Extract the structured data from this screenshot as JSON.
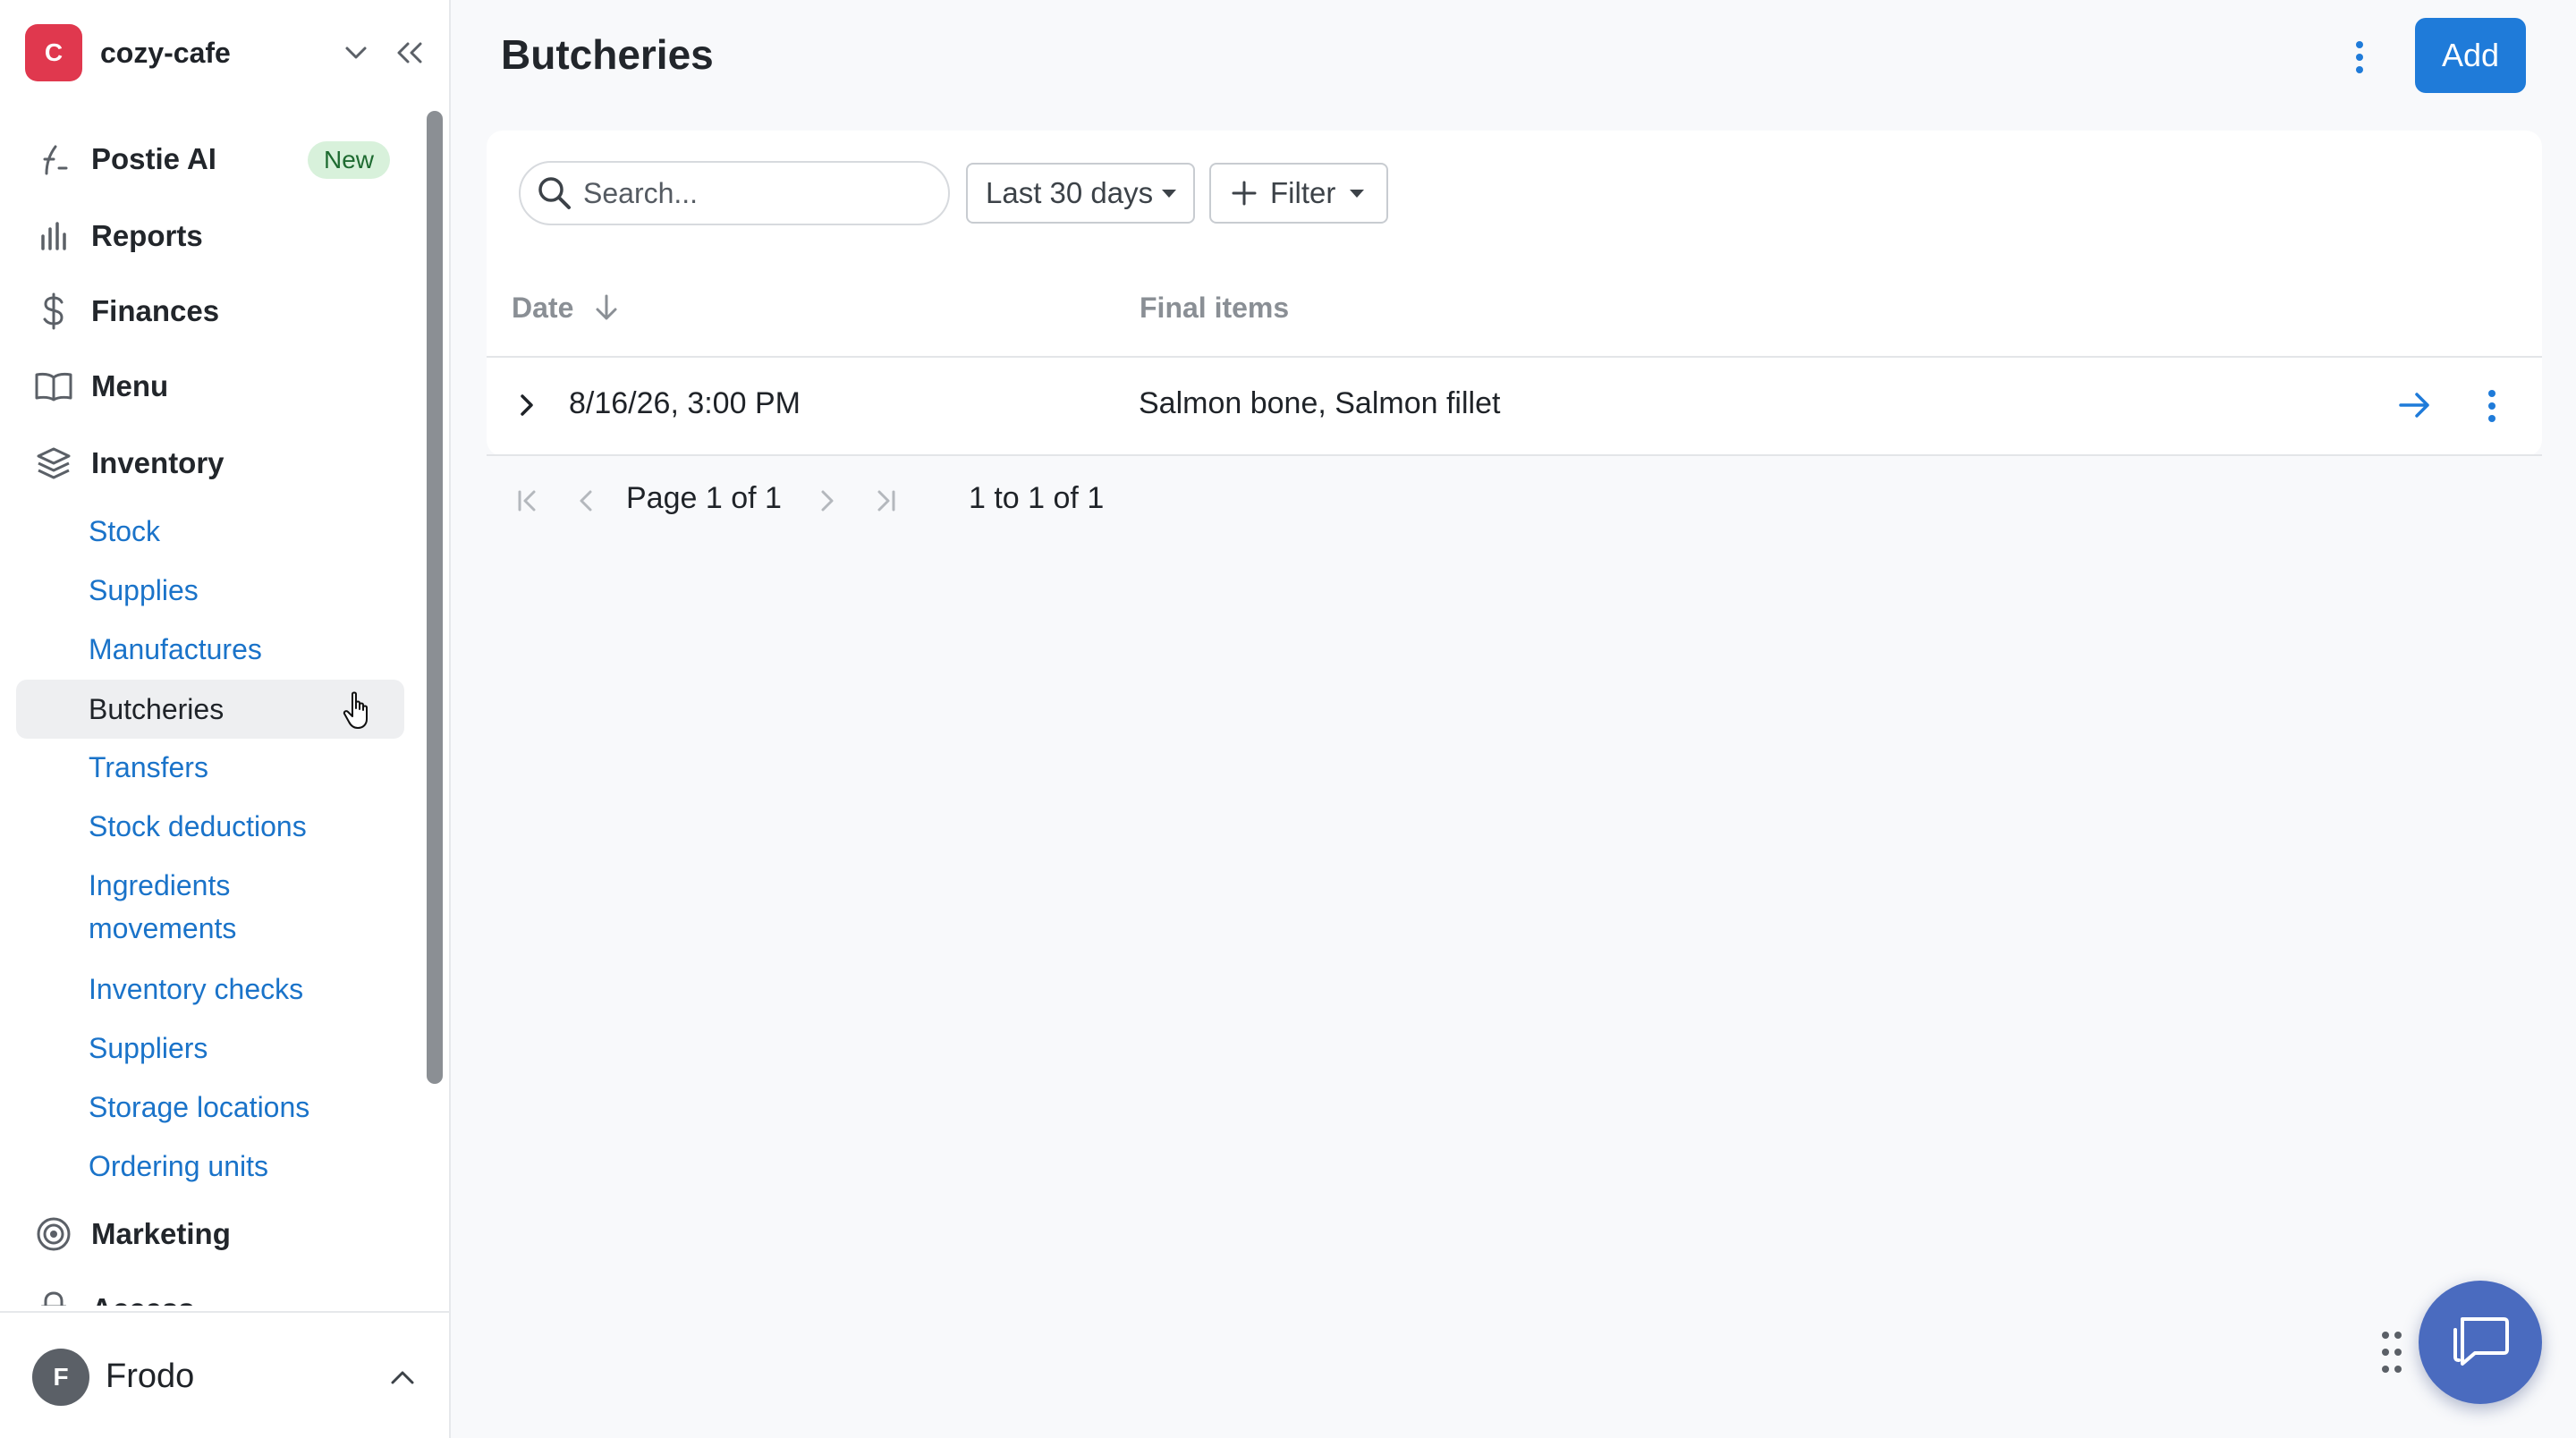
{
  "workspace": {
    "initial": "C",
    "name": "cozy-cafe"
  },
  "nav": {
    "postie_ai": {
      "label": "Postie AI",
      "badge": "New"
    },
    "reports": {
      "label": "Reports"
    },
    "finances": {
      "label": "Finances"
    },
    "menu": {
      "label": "Menu"
    },
    "inventory": {
      "label": "Inventory"
    },
    "inventory_sub": [
      "Stock",
      "Supplies",
      "Manufactures",
      "Butcheries",
      "Transfers",
      "Stock deductions",
      "Ingredients",
      "movements",
      "Inventory checks",
      "Suppliers",
      "Storage locations",
      "Ordering units"
    ],
    "marketing": {
      "label": "Marketing"
    },
    "access": {
      "label": "Access"
    }
  },
  "user": {
    "initial": "F",
    "name": "Frodo"
  },
  "page": {
    "title": "Butcheries",
    "add_label": "Add"
  },
  "toolbar": {
    "search_placeholder": "Search...",
    "date_range": "Last 30 days",
    "filter_label": "Filter"
  },
  "table": {
    "columns": [
      "Date",
      "Final items"
    ],
    "rows": [
      {
        "date": "8/16/26, 3:00 PM",
        "final_items": "Salmon bone, Salmon fillet"
      }
    ]
  },
  "pagination": {
    "page_text": "Page 1 of 1",
    "range_text": "1 to 1 of 1"
  },
  "colors": {
    "accent": "#1f7bd9",
    "link": "#1a73c9",
    "logo": "#e0384e",
    "chat": "#4a6bbf"
  }
}
